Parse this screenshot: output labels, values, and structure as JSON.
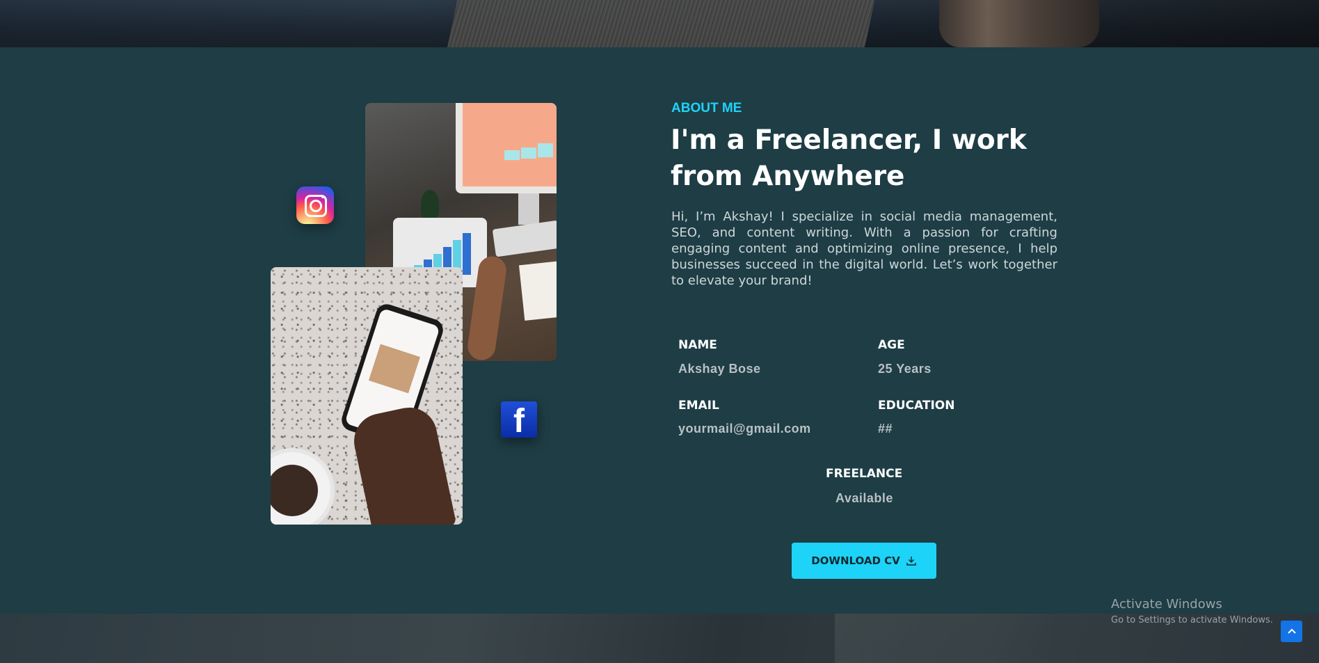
{
  "about": {
    "section_label": "ABOUT ME",
    "headline": "I'm a Freelancer, I work from Anywhere",
    "bio": "Hi, I’m Akshay! I specialize in social media management, SEO, and content writing. With a passion for crafting engaging content and optimizing online presence, I help businesses succeed in the digital world. Let’s work together to elevate your brand!"
  },
  "info": {
    "name_label": "NAME",
    "name_value": "Akshay Bose",
    "age_label": "AGE",
    "age_value": "25 Years",
    "email_label": "EMAIL",
    "email_value": "yourmail@gmail.com",
    "education_label": "EDUCATION",
    "education_value": "##",
    "freelance_label": "FREELANCE",
    "freelance_value": "Available"
  },
  "actions": {
    "download_cv_label": "DOWNLOAD CV",
    "download_icon": "download-icon",
    "back_to_top_icon": "arrow-up-icon"
  },
  "social": {
    "instagram_icon": "instagram-icon",
    "facebook_icon": "facebook-icon",
    "facebook_glyph": "f"
  },
  "watermark": {
    "title": "Activate Windows",
    "subtitle": "Go to Settings to activate Windows."
  },
  "colors": {
    "background": "#1e3d45",
    "accent": "#1ed3f8",
    "heading": "#ffffff",
    "body_text": "#cdd7da"
  }
}
